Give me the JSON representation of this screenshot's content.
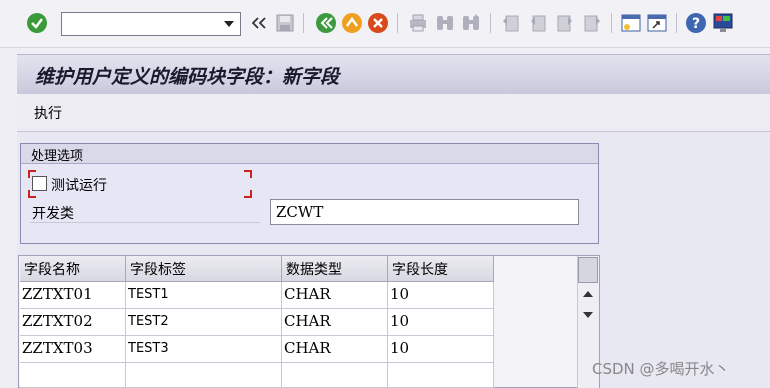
{
  "toolbar": {
    "command_field_value": "",
    "icons": [
      "enter-checkmark",
      "command-dropdown",
      "collapse-double-arrow",
      "save",
      "back",
      "exit",
      "cancel",
      "print",
      "find",
      "find-next",
      "first-page",
      "previous-page",
      "next-page",
      "last-page",
      "new-session",
      "shortcut",
      "help",
      "customize-layout"
    ]
  },
  "title": "维护用户定义的编码块字段：新字段",
  "app_toolbar": {
    "execute_label": "执行"
  },
  "processing_options": {
    "group_title": "处理选项",
    "test_run_label": "测试运行",
    "test_run_checked": false,
    "dev_class_label": "开发类",
    "dev_class_value": "ZCWT"
  },
  "table": {
    "columns": [
      "字段名称",
      "字段标签",
      "数据类型",
      "字段长度"
    ],
    "rows": [
      [
        "ZZTXT01",
        "TEST1",
        "CHAR",
        "10"
      ],
      [
        "ZZTXT02",
        "TEST2",
        "CHAR",
        "10"
      ],
      [
        "ZZTXT03",
        "TEST3",
        "CHAR",
        "10"
      ]
    ]
  },
  "watermark": "CSDN @多喝开水丶",
  "colors": {
    "title_text": "#1a1a2e",
    "frame_border": "#8a8ab0",
    "required_corner": "#cc2222"
  }
}
